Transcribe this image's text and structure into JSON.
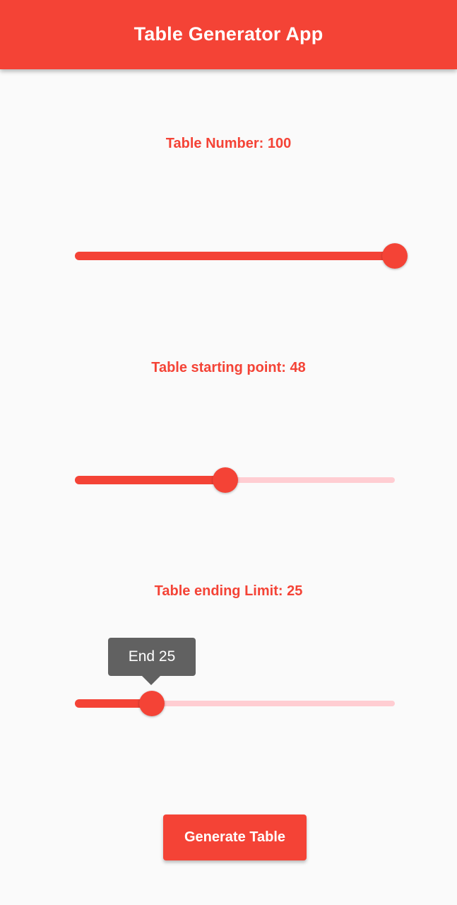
{
  "app_bar": {
    "title": "Table Generator App"
  },
  "colors": {
    "accent": "#f44336",
    "track_inactive": "#ffcdd2",
    "tooltip_bg": "#616161",
    "background": "#fafafa"
  },
  "sliders": [
    {
      "label": "Table Number:  100",
      "value": 100,
      "fraction": 1.0
    },
    {
      "label": "Table starting point:  48",
      "value": 48,
      "fraction": 0.47
    },
    {
      "label": "Table ending Limit:  25",
      "value": 25,
      "fraction": 0.24,
      "tooltip": "End 25"
    }
  ],
  "button": {
    "label": "Generate Table"
  }
}
